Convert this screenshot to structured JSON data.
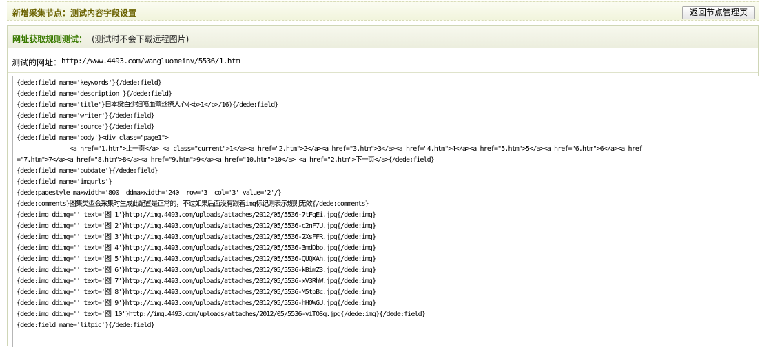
{
  "header": {
    "title": "新增采集节点：测试内容字段设置",
    "back_button": "返回节点管理页"
  },
  "panel": {
    "title": "网址获取规则测试：",
    "note": "(测试时不会下载远程图片)"
  },
  "url_row": {
    "label": "测试的网址：",
    "value": "http://www.4493.com/wangluomeinv/5536/1.htm"
  },
  "result_lines": [
    "{dede:field name='keywords'}{/dede:field}",
    "{dede:field name='description'}{/dede:field}",
    "{dede:field name='title'}日本嫩白少妇喷血蕾丝撩人心(<b>1</b>/16){/dede:field}",
    "{dede:field name='writer'}{/dede:field}",
    "{dede:field name='source'}{/dede:field}",
    "{dede:field name='body'}<div class=\"page1\">",
    "               <a href=\"1.htm\">上一页</a> <a class=\"current\">1</a><a href=\"2.htm\">2</a><a href=\"3.htm\">3</a><a href=\"4.htm\">4</a><a href=\"5.htm\">5</a><a href=\"6.htm\">6</a><a href",
    "=\"7.htm\">7</a><a href=\"8.htm\">8</a><a href=\"9.htm\">9</a><a href=\"10.htm\">10</a> <a href=\"2.htm\">下一页</a>{/dede:field}",
    "{dede:field name='pubdate'}{/dede:field}",
    "{dede:field name='imgurls'}",
    "{dede:pagestyle maxwidth='800' ddmaxwidth='240' row='3' col='3' value='2'/}",
    "{dede:comments}图集类型会采集时生成此配置是正常的，不过如果后面没有跟着img标记则表示规则无效{/dede:comments}",
    "{dede:img ddimg='' text='图 1'}http://img.4493.com/uploads/attaches/2012/05/5536-7tFgEi.jpg{/dede:img}",
    "{dede:img ddimg='' text='图 2'}http://img.4493.com/uploads/attaches/2012/05/5536-c2nF7U.jpg{/dede:img}",
    "{dede:img ddimg='' text='图 3'}http://img.4493.com/uploads/attaches/2012/05/5536-2XsFFR.jpg{/dede:img}",
    "{dede:img ddimg='' text='图 4'}http://img.4493.com/uploads/attaches/2012/05/5536-3mdDbp.jpg{/dede:img}",
    "{dede:img ddimg='' text='图 5'}http://img.4493.com/uploads/attaches/2012/05/5536-QUQXAh.jpg{/dede:img}",
    "{dede:img ddimg='' text='图 6'}http://img.4493.com/uploads/attaches/2012/05/5536-kBimZ3.jpg{/dede:img}",
    "{dede:img ddimg='' text='图 7'}http://img.4493.com/uploads/attaches/2012/05/5536-xV3RhW.jpg{/dede:img}",
    "{dede:img ddimg='' text='图 8'}http://img.4493.com/uploads/attaches/2012/05/5536-M5tpBc.jpg{/dede:img}",
    "{dede:img ddimg='' text='图 9'}http://img.4493.com/uploads/attaches/2012/05/5536-hHOWGU.jpg{/dede:img}",
    "{dede:img ddimg='' text='图 10'}http://img.4493.com/uploads/attaches/2012/05/5536-viTOSq.jpg{/dede:img}{/dede:field}",
    "{dede:field name='litpic'}{/dede:field}"
  ]
}
